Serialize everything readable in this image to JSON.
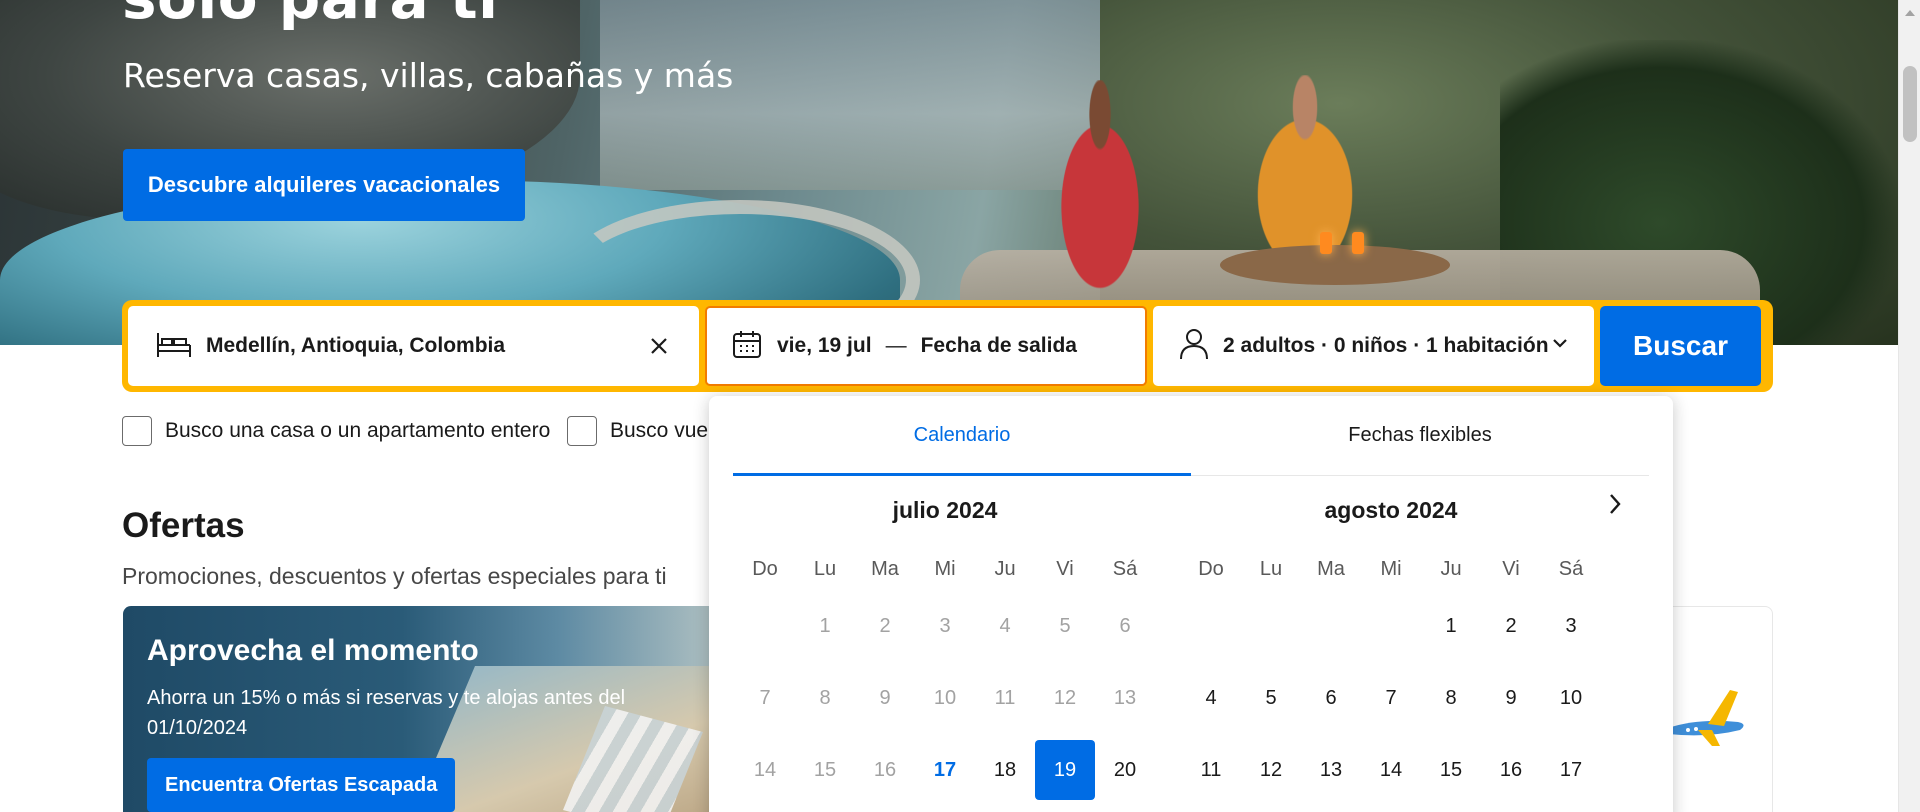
{
  "hero": {
    "title": "solo para ti",
    "subtitle": "Reserva casas, villas, cabañas y más",
    "cta_label": "Descubre alquileres vacacionales"
  },
  "search": {
    "destination": "Medellín, Antioquia, Colombia",
    "checkin": "vie, 19 jul",
    "separator": "—",
    "checkout": "Fecha de salida",
    "guests": "2 adultos · 0 niños · 1 habitación",
    "button_label": "Buscar"
  },
  "checkboxes": [
    {
      "label": "Busco una casa o un apartamento entero",
      "checked": false
    },
    {
      "label": "Busco vuel",
      "checked": false
    }
  ],
  "offers": {
    "title": "Ofertas",
    "subtitle": "Promociones, descuentos y ofertas especiales para ti",
    "card": {
      "title": "Aprovecha el momento",
      "text": "Ahorra un 15% o más si reservas y te alojas antes del 01/10/2024",
      "button_label": "Encuentra Ofertas Escapada"
    }
  },
  "datepicker": {
    "tabs": [
      "Calendario",
      "Fechas flexibles"
    ],
    "active_tab": 0,
    "weekdays": [
      "Do",
      "Lu",
      "Ma",
      "Mi",
      "Ju",
      "Vi",
      "Sá"
    ],
    "months": [
      {
        "title": "julio 2024",
        "weeks": [
          [
            "",
            "1",
            "2",
            "3",
            "4",
            "5",
            "6"
          ],
          [
            "7",
            "8",
            "9",
            "10",
            "11",
            "12",
            "13"
          ],
          [
            "14",
            "15",
            "16",
            "17",
            "18",
            "19",
            "20"
          ]
        ],
        "past_until": 16,
        "today": "17",
        "selected": "19"
      },
      {
        "title": "agosto 2024",
        "weeks": [
          [
            "",
            "",
            "",
            "",
            "1",
            "2",
            "3"
          ],
          [
            "4",
            "5",
            "6",
            "7",
            "8",
            "9",
            "10"
          ],
          [
            "11",
            "12",
            "13",
            "14",
            "15",
            "16",
            "17"
          ]
        ]
      }
    ]
  },
  "colors": {
    "primary": "#006ce4",
    "searchbar_border": "#ffb700",
    "active_field_border": "#f27c00"
  },
  "icons": {
    "destination": "bed-icon",
    "clear": "close-icon",
    "dates": "calendar-icon",
    "guests": "person-icon",
    "dropdown": "chevron-down-icon",
    "next_month": "chevron-right-icon"
  }
}
